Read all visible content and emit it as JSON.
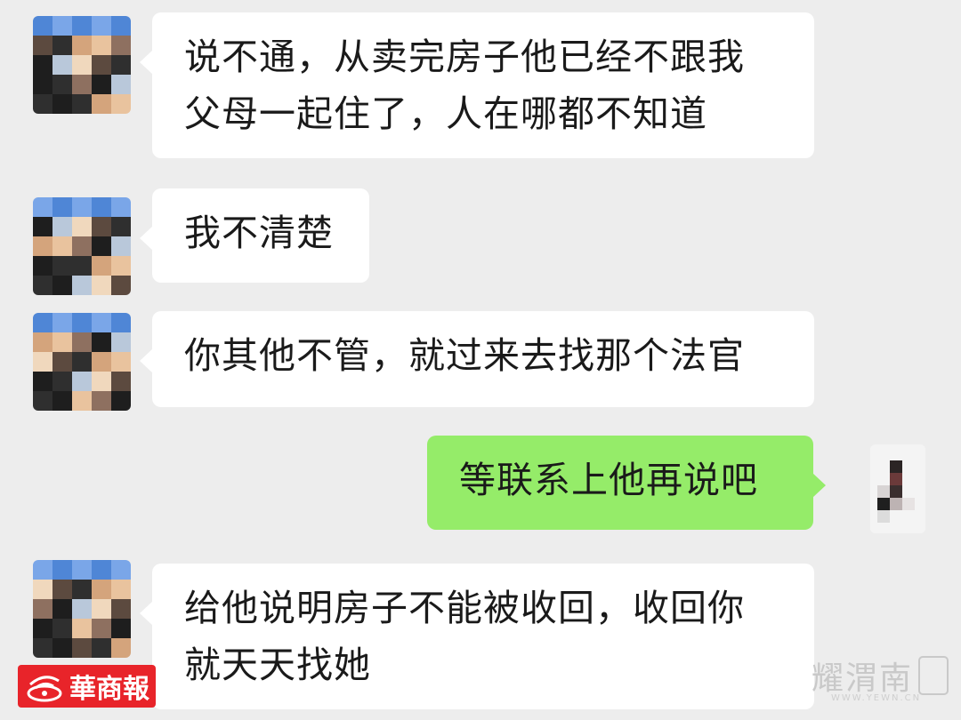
{
  "messages": [
    {
      "side": "left",
      "text": "说不通，从卖完房子他已经不跟我\n父母一起住了，人在哪都不知道",
      "avatar": "pixelated-avatar"
    },
    {
      "side": "left",
      "text": "我不清楚",
      "avatar": "pixelated-avatar"
    },
    {
      "side": "left",
      "text": "你其他不管，就过来去找那个法官",
      "avatar": "pixelated-avatar"
    },
    {
      "side": "right",
      "text": "等联系上他再说吧",
      "avatar": "pixelated-avatar-self"
    },
    {
      "side": "left",
      "text": "给他说明房子不能被收回，收回你\n就天天找她",
      "avatar": "pixelated-avatar"
    }
  ],
  "watermarks": {
    "left_logo": "華商報",
    "right_logo": "耀渭南",
    "right_sub": "WWW.YEWN.CN"
  },
  "colors": {
    "background": "#ededed",
    "bubble_other": "#ffffff",
    "bubble_self": "#95ec69",
    "logo_red": "#e8242a"
  }
}
